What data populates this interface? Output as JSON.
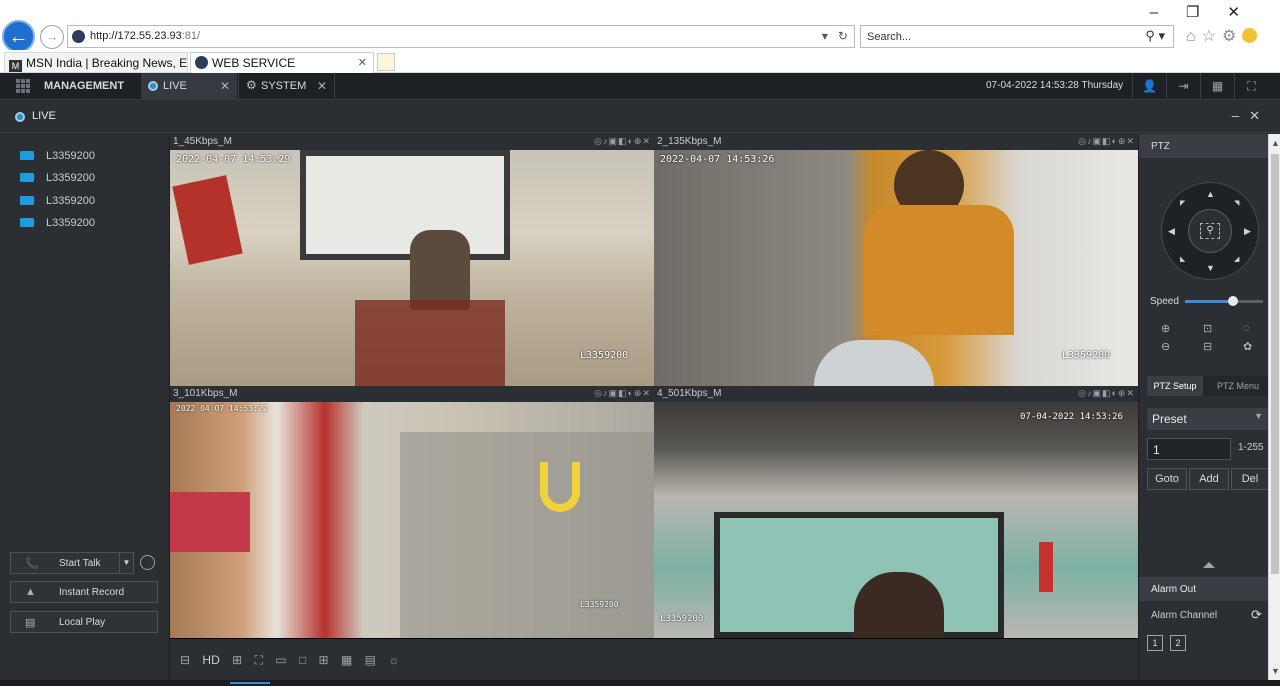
{
  "browser": {
    "url_host": "http://172.55.23.93",
    "url_rest": ":81/",
    "search_placeholder": "Search...",
    "tabs": [
      {
        "label": "MSN India | Breaking News, En...",
        "favicon": "msn-icon"
      },
      {
        "label": "WEB SERVICE",
        "favicon": "globe-icon"
      }
    ]
  },
  "app": {
    "management_label": "MANAGEMENT",
    "tabs": [
      {
        "label": "LIVE",
        "icon": "live-dot-icon"
      },
      {
        "label": "SYSTEM",
        "icon": "gear-icon"
      }
    ],
    "datetime": "07-04-2022 14:53:28 Thursday"
  },
  "live_bar": {
    "title": "LIVE"
  },
  "devices": [
    {
      "name": "L3359200"
    },
    {
      "name": "L3359200"
    },
    {
      "name": "L3359200"
    },
    {
      "name": "L3359200"
    }
  ],
  "left_buttons": {
    "start_talk": "Start Talk",
    "instant_record": "Instant Record",
    "local_play": "Local Play"
  },
  "panes": [
    {
      "title": "1_45Kbps_M",
      "osd_time": "2022-04-07 14:53:29",
      "osd_name": "L3359200"
    },
    {
      "title": "2_135Kbps_M",
      "osd_time": "2022-04-07 14:53:26",
      "osd_name": "L3359200"
    },
    {
      "title": "3_101Kbps_M",
      "osd_time": "2022 04 07 14:53:22",
      "osd_name": "L3359200"
    },
    {
      "title": "4_501Kbps_M",
      "osd_time": "07-04-2022 14:53:26",
      "osd_name": "L3359200"
    }
  ],
  "bottom_bar": {
    "hd_label": "HD"
  },
  "ptz": {
    "title": "PTZ",
    "speed_label": "Speed",
    "speed_fraction": 0.62,
    "setup_tab": "PTZ Setup",
    "menu_tab": "PTZ Menu",
    "preset_label": "Preset",
    "preset_value": "1",
    "preset_range": "1-255",
    "goto": "Goto",
    "add": "Add",
    "del": "Del",
    "alarm_out": "Alarm Out",
    "alarm_channel": "Alarm Channel",
    "channels": [
      "1",
      "2"
    ]
  }
}
